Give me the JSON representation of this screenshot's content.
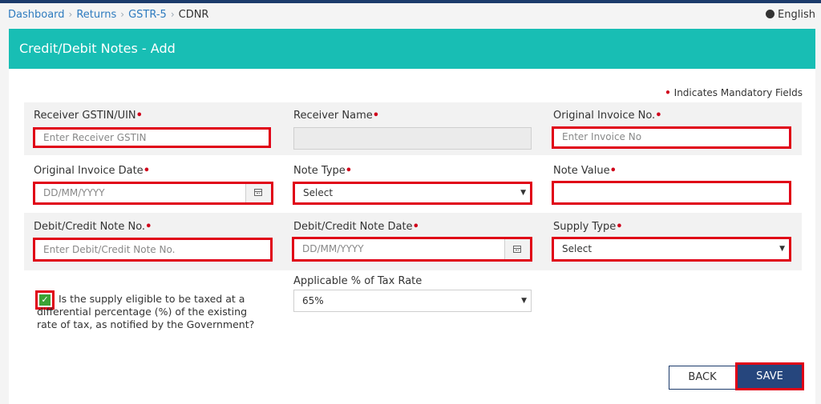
{
  "breadcrumb": {
    "items": [
      "Dashboard",
      "Returns",
      "GSTR-5"
    ],
    "current": "CDNR",
    "separator": "›"
  },
  "language": {
    "label": "English",
    "icon": "globe-icon"
  },
  "panel": {
    "title": "Credit/Debit Notes - Add",
    "mandatory_text": "Indicates Mandatory Fields",
    "required_marker": "•"
  },
  "fields": {
    "receiver_gstin": {
      "label": "Receiver GSTIN/UIN",
      "placeholder": "Enter Receiver GSTIN",
      "value": ""
    },
    "receiver_name": {
      "label": "Receiver Name",
      "value": ""
    },
    "original_invoice_no": {
      "label": "Original Invoice No.",
      "placeholder": "Enter Invoice No",
      "value": ""
    },
    "original_invoice_date": {
      "label": "Original Invoice Date",
      "placeholder": "DD/MM/YYYY",
      "value": ""
    },
    "note_type": {
      "label": "Note Type",
      "selected": "Select"
    },
    "note_value": {
      "label": "Note Value",
      "value": ""
    },
    "note_no": {
      "label": "Debit/Credit Note No.",
      "placeholder": "Enter Debit/Credit Note No.",
      "value": ""
    },
    "note_date": {
      "label": "Debit/Credit Note Date",
      "placeholder": "DD/MM/YYYY",
      "value": ""
    },
    "supply_type": {
      "label": "Supply Type",
      "selected": "Select"
    },
    "tax_rate": {
      "label": "Applicable % of Tax Rate",
      "selected": "65%"
    }
  },
  "differential_checkbox": {
    "checked": true,
    "text": "Is the supply eligible to be taxed at a differential percentage (%) of the existing rate of tax, as notified by the Government?"
  },
  "buttons": {
    "back": "BACK",
    "save": "SAVE"
  },
  "colors": {
    "header": "#18beb4",
    "highlight_border": "#e00016",
    "save_button": "#26467d",
    "link": "#2e7bbf",
    "required_dot": "#d0021b"
  }
}
